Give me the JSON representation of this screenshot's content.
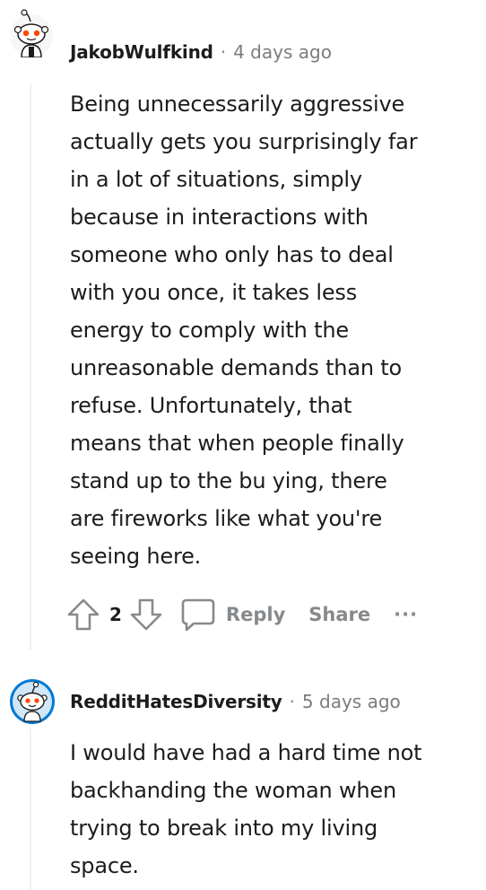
{
  "comments": [
    {
      "username": "JakobWulfkind",
      "separator": "·",
      "timestamp": "4 days ago",
      "avatar_icon": "snoo-avatar-icon",
      "body": "Being unnecessarily aggressive\nactually gets you surprisingly far\nin a lot of situations, simply\nbecause in interactions with\nsomeone who only has to deal\nwith you once, it takes less\nenergy to comply with the\nunreasonable demands than to\nrefuse. Unfortunately, that\nmeans that when people finally\nstand up to the bu  ying, there\nare fireworks like what you're\nseeing here.",
      "score": "2",
      "reply_label": "Reply",
      "share_label": "Share",
      "more_label": "···"
    },
    {
      "username": "RedditHatesDiversity",
      "separator": "·",
      "timestamp": "5 days ago",
      "avatar_icon": "snoo-avatar-icon",
      "body": "I would have had a hard time not\nbackhanding the woman when\ntrying to break into my living\nspace."
    }
  ],
  "colors": {
    "text": "#1c1c1c",
    "muted": "#878a8c",
    "thread_line": "#edeff1",
    "avatar_blue": "#0079d3"
  }
}
